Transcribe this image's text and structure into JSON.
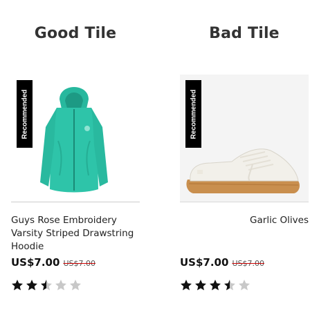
{
  "columns": [
    {
      "heading": "Good Tile",
      "badge": "Recommended",
      "product_name": "Guys Rose Embroidery Varsity Striped Drawstring Hoodie",
      "price": "US$7.00",
      "original_price": "US$7.00",
      "rating": 2.5,
      "rating_max": 5,
      "product_image": "teal-fleece-hoodie",
      "colors": {
        "product": "#2ec4a9"
      }
    },
    {
      "heading": "Bad Tile",
      "badge": "Recommended",
      "product_name": "Garlic Olives",
      "price": "US$7.00",
      "original_price": "US$7.00",
      "rating": 3.5,
      "rating_max": 5,
      "product_image": "white-sneaker-gum-sole",
      "colors": {
        "product": "#f2f0ea",
        "sole": "#c98f4e"
      }
    }
  ],
  "colors": {
    "star_filled": "#111111",
    "star_empty": "#c8c8c8",
    "strike": "#cc0000",
    "badge_bg": "#000000",
    "image_bg_bad": "#f4f4f4"
  }
}
